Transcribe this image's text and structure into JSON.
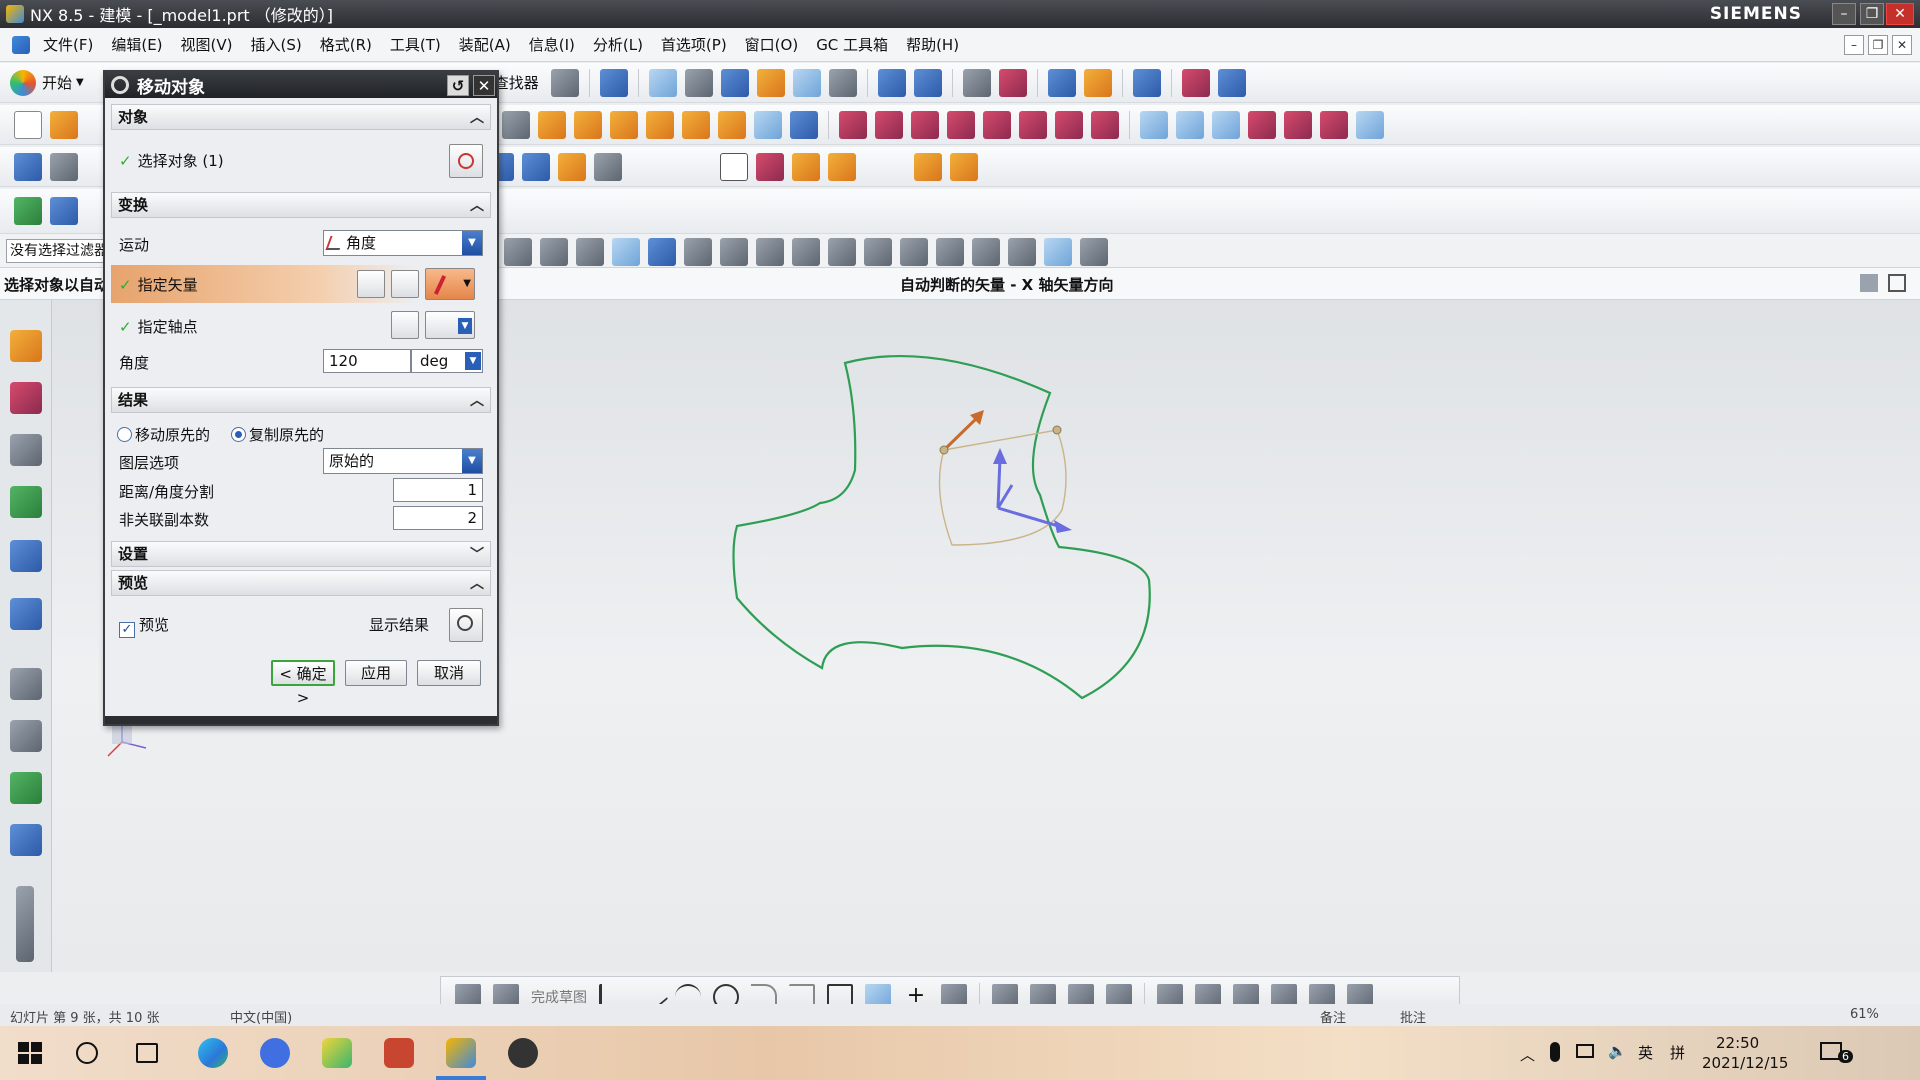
{
  "window": {
    "title": "NX 8.5 - 建模 - [_model1.prt （修改的）]",
    "brand": "SIEMENS"
  },
  "menu": [
    "文件(F)",
    "编辑(E)",
    "视图(V)",
    "插入(S)",
    "格式(R)",
    "工具(T)",
    "装配(A)",
    "信息(I)",
    "分析(L)",
    "首选项(P)",
    "窗口(O)",
    "GC 工具箱",
    "帮助(H)"
  ],
  "toolbar": {
    "start_label": "开始",
    "finder_label": "查找器"
  },
  "selection": {
    "filter_value": "没有选择过滤器"
  },
  "cue": {
    "left": "选择对象以自动判断矢量",
    "center": "自动判断的矢量 - X 轴矢量方向"
  },
  "dialog": {
    "title": "移动对象",
    "sections": {
      "object": "对象",
      "transform": "变换",
      "result": "结果",
      "settings": "设置",
      "preview": "预览"
    },
    "select_object": "选择对象 (1)",
    "motion_label": "运动",
    "motion_value": "角度",
    "specify_vector": "指定矢量",
    "specify_axis_point": "指定轴点",
    "angle_label": "角度",
    "angle_value": "120",
    "angle_unit": "deg",
    "move_original": "移动原先的",
    "copy_original": "复制原先的",
    "layer_option_label": "图层选项",
    "layer_option_value": "原始的",
    "distance_angle_divisions_label": "距离/角度分割",
    "distance_angle_divisions_value": "1",
    "non_associative_copies_label": "非关联副本数",
    "non_associative_copies_value": "2",
    "preview_label": "预览",
    "show_result_label": "显示结果",
    "ok_label": "< 确定 >",
    "apply_label": "应用",
    "cancel_label": "取消"
  },
  "sketch_bar": {
    "finish_sketch_label": "完成草图"
  },
  "statusbar": {
    "slide_info": "幻灯片 第 9 张，共 10 张",
    "lang": "中文(中国)",
    "notes": "备注",
    "comments": "批注",
    "zoom": "61%"
  },
  "taskbar": {
    "time": "22:50",
    "date": "2021/12/15",
    "ime_lang": "英",
    "ime_mode": "拼",
    "notification_count": "6"
  },
  "colors": {
    "title_bg": "#2b2d31",
    "accent": "#2a5fb8",
    "profile_green": "#2f9e55",
    "ok_green": "#3aa53a"
  }
}
